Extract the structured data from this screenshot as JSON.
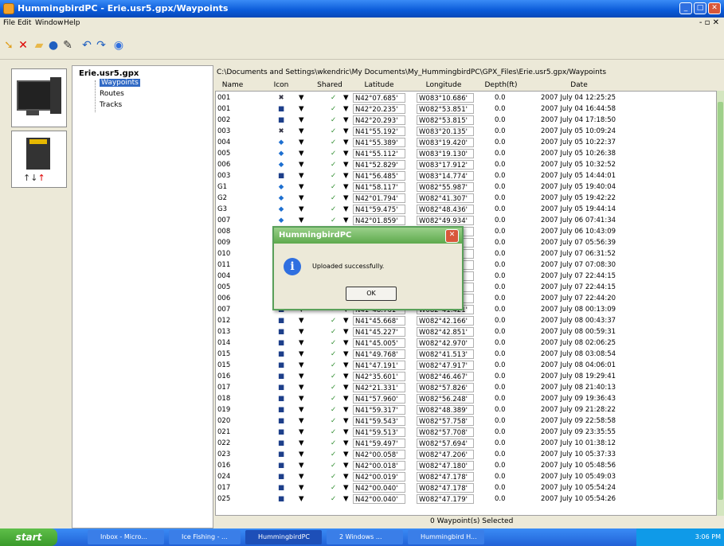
{
  "window": {
    "title": "HummingbirdPC - Erie.usr5.gpx/Waypoints"
  },
  "menu": {
    "items": [
      "File",
      "Edit",
      "Window",
      "Help"
    ]
  },
  "tree": {
    "root": "Erie.usr5.gpx",
    "children": [
      "Waypoints",
      "Routes",
      "Tracks"
    ],
    "selected": "Waypoints"
  },
  "path": "C:\\Documents and Settings\\wkendric\\My Documents\\My_HummingbirdPC\\GPX_Files\\Erie.usr5.gpx/Waypoints",
  "columns": [
    "Name",
    "Icon",
    "Shared",
    "Latitude",
    "Longitude",
    "Depth(ft)",
    "Date"
  ],
  "rows": [
    {
      "name": "001",
      "icon": "fish",
      "lat": "N42°07.685'",
      "lon": "W083°10.686'",
      "depth": "0.0",
      "date": "2007 July 04 12:25:25"
    },
    {
      "name": "001",
      "icon": "box",
      "lat": "N42°20.235'",
      "lon": "W082°53.851'",
      "depth": "0.0",
      "date": "2007 July 04 16:44:58"
    },
    {
      "name": "002",
      "icon": "box",
      "lat": "N42°20.293'",
      "lon": "W082°53.815'",
      "depth": "0.0",
      "date": "2007 July 04 17:18:50"
    },
    {
      "name": "003",
      "icon": "fish",
      "lat": "N41°55.192'",
      "lon": "W083°20.135'",
      "depth": "0.0",
      "date": "2007 July 05 10:09:24"
    },
    {
      "name": "004",
      "icon": "dot",
      "lat": "N41°55.389'",
      "lon": "W083°19.420'",
      "depth": "0.0",
      "date": "2007 July 05 10:22:37"
    },
    {
      "name": "005",
      "icon": "dot",
      "lat": "N41°55.112'",
      "lon": "W083°19.130'",
      "depth": "0.0",
      "date": "2007 July 05 10:26:38"
    },
    {
      "name": "006",
      "icon": "dot",
      "lat": "N41°52.829'",
      "lon": "W083°17.912'",
      "depth": "0.0",
      "date": "2007 July 05 10:32:52"
    },
    {
      "name": "003",
      "icon": "box",
      "lat": "N41°56.485'",
      "lon": "W083°14.774'",
      "depth": "0.0",
      "date": "2007 July 05 14:44:01"
    },
    {
      "name": "G1",
      "icon": "dot",
      "lat": "N41°58.117'",
      "lon": "W082°55.987'",
      "depth": "0.0",
      "date": "2007 July 05 19:40:04"
    },
    {
      "name": "G2",
      "icon": "dot",
      "lat": "N42°01.794'",
      "lon": "W082°41.307'",
      "depth": "0.0",
      "date": "2007 July 05 19:42:22"
    },
    {
      "name": "G3",
      "icon": "dot",
      "lat": "N41°59.475'",
      "lon": "W082°48.436'",
      "depth": "0.0",
      "date": "2007 July 05 19:44:14"
    },
    {
      "name": "007",
      "icon": "dot",
      "lat": "N42°01.859'",
      "lon": "W082°49.934'",
      "depth": "0.0",
      "date": "2007 July 06 07:41:34"
    },
    {
      "name": "008",
      "icon": "dot",
      "lat": "",
      "lon": "…31'",
      "depth": "0.0",
      "date": "2007 July 06 10:43:09"
    },
    {
      "name": "009",
      "icon": "dot",
      "lat": "",
      "lon": "…28'",
      "depth": "0.0",
      "date": "2007 July 07 05:56:39"
    },
    {
      "name": "010",
      "icon": "dot",
      "lat": "",
      "lon": "…07'",
      "depth": "0.0",
      "date": "2007 July 07 06:31:52"
    },
    {
      "name": "011",
      "icon": "dot",
      "lat": "",
      "lon": "…99'",
      "depth": "0.0",
      "date": "2007 July 07 07:08:30"
    },
    {
      "name": "004",
      "icon": "dot",
      "lat": "",
      "lon": "…17'",
      "depth": "0.0",
      "date": "2007 July 07 22:44:15"
    },
    {
      "name": "005",
      "icon": "dot",
      "lat": "",
      "lon": "…17'",
      "depth": "0.0",
      "date": "2007 July 07 22:44:15"
    },
    {
      "name": "006",
      "icon": "dot",
      "lat": "",
      "lon": "…16'",
      "depth": "0.0",
      "date": "2007 July 07 22:44:20"
    },
    {
      "name": "007",
      "icon": "box",
      "lat": "N41°48.761'",
      "lon": "W082°41.421'",
      "depth": "0.0",
      "date": "2007 July 08 00:13:09"
    },
    {
      "name": "012",
      "icon": "box",
      "lat": "N41°45.668'",
      "lon": "W082°42.166'",
      "depth": "0.0",
      "date": "2007 July 08 00:43:37"
    },
    {
      "name": "013",
      "icon": "box",
      "lat": "N41°45.227'",
      "lon": "W082°42.851'",
      "depth": "0.0",
      "date": "2007 July 08 00:59:31"
    },
    {
      "name": "014",
      "icon": "box",
      "lat": "N41°45.005'",
      "lon": "W082°42.970'",
      "depth": "0.0",
      "date": "2007 July 08 02:06:25"
    },
    {
      "name": "015",
      "icon": "box",
      "lat": "N41°49.768'",
      "lon": "W082°41.513'",
      "depth": "0.0",
      "date": "2007 July 08 03:08:54"
    },
    {
      "name": "015",
      "icon": "box",
      "lat": "N41°47.191'",
      "lon": "W082°47.917'",
      "depth": "0.0",
      "date": "2007 July 08 04:06:01"
    },
    {
      "name": "016",
      "icon": "box",
      "lat": "N42°35.601'",
      "lon": "W082°46.467'",
      "depth": "0.0",
      "date": "2007 July 08 19:29:41"
    },
    {
      "name": "017",
      "icon": "box",
      "lat": "N42°21.331'",
      "lon": "W082°57.826'",
      "depth": "0.0",
      "date": "2007 July 08 21:40:13"
    },
    {
      "name": "018",
      "icon": "box",
      "lat": "N41°57.960'",
      "lon": "W082°56.248'",
      "depth": "0.0",
      "date": "2007 July 09 19:36:43"
    },
    {
      "name": "019",
      "icon": "box",
      "lat": "N41°59.317'",
      "lon": "W082°48.389'",
      "depth": "0.0",
      "date": "2007 July 09 21:28:22"
    },
    {
      "name": "020",
      "icon": "box",
      "lat": "N41°59.543'",
      "lon": "W082°57.758'",
      "depth": "0.0",
      "date": "2007 July 09 22:58:58"
    },
    {
      "name": "021",
      "icon": "box",
      "lat": "N41°59.513'",
      "lon": "W082°57.708'",
      "depth": "0.0",
      "date": "2007 July 09 23:35:55"
    },
    {
      "name": "022",
      "icon": "box",
      "lat": "N41°59.497'",
      "lon": "W082°57.694'",
      "depth": "0.0",
      "date": "2007 July 10 01:38:12"
    },
    {
      "name": "023",
      "icon": "box",
      "lat": "N42°00.058'",
      "lon": "W082°47.206'",
      "depth": "0.0",
      "date": "2007 July 10 05:37:33"
    },
    {
      "name": "016",
      "icon": "box",
      "lat": "N42°00.018'",
      "lon": "W082°47.180'",
      "depth": "0.0",
      "date": "2007 July 10 05:48:56"
    },
    {
      "name": "024",
      "icon": "box",
      "lat": "N42°00.019'",
      "lon": "W082°47.178'",
      "depth": "0.0",
      "date": "2007 July 10 05:49:03"
    },
    {
      "name": "017",
      "icon": "box",
      "lat": "N42°00.040'",
      "lon": "W082°47.178'",
      "depth": "0.0",
      "date": "2007 July 10 05:54:24"
    },
    {
      "name": "025",
      "icon": "box",
      "lat": "N42°00.040'",
      "lon": "W082°47.179'",
      "depth": "0.0",
      "date": "2007 July 10 05:54:26"
    }
  ],
  "status": "0 Waypoint(s) Selected",
  "dialog": {
    "title": "HummingbirdPC",
    "message": "Uploaded successfully.",
    "ok": "OK"
  },
  "taskbar": {
    "start": "start",
    "tasks": [
      "Inbox - Micro...",
      "Ice Fishing - ...",
      "HummingbirdPC",
      "2 Windows ...",
      "Hummingbird H..."
    ],
    "clock": "3:06 PM"
  },
  "colors": {
    "titlebar": "#0a5ad8",
    "dialog_title": "#5da94c",
    "taskbar": "#2161d6"
  }
}
